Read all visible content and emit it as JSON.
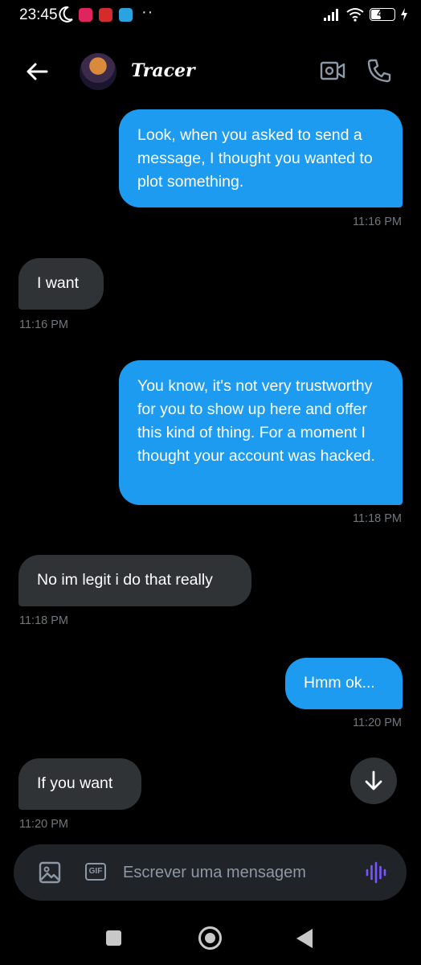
{
  "status_bar": {
    "time": "23:45",
    "battery": 48,
    "battery_label": "48"
  },
  "header": {
    "contact_name": "Tracer"
  },
  "conversation": {
    "messages": [
      {
        "direction": "sent",
        "text": "Look, when you asked to send a message, I thought you wanted to plot something.",
        "time": "11:16 PM"
      },
      {
        "direction": "received",
        "text": "I want",
        "time": "11:16 PM"
      },
      {
        "direction": "sent",
        "text": "You know, it's not very trustworthy for you to show up here and offer this kind of thing. For a moment I thought your account was hacked.",
        "time": "11:18 PM"
      },
      {
        "direction": "received",
        "text": "No im legit i do that really",
        "time": "11:18 PM"
      },
      {
        "direction": "sent",
        "text": "Hmm ok...",
        "time": "11:20 PM"
      },
      {
        "direction": "received",
        "text": "If you want",
        "time": "11:20 PM"
      }
    ]
  },
  "composer": {
    "gif_label": "GIF",
    "placeholder": "Escrever uma mensagem"
  },
  "colors": {
    "sent_bubble": "#1d9bf0",
    "received_bubble": "#2f3336",
    "timestamp": "#71767b",
    "voice_accent": "#7856ff"
  }
}
